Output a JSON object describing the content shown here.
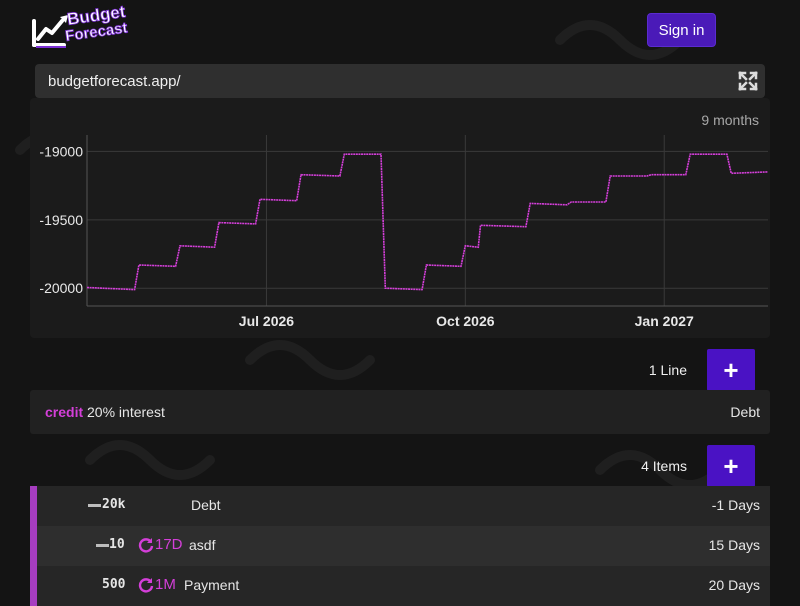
{
  "header": {
    "logo_line1": "Budget",
    "logo_line2": "Forecast",
    "signin_label": "Sign in"
  },
  "urlbar": {
    "value": "budgetforecast.app/"
  },
  "colors": {
    "accent": "#d43fd9",
    "button": "#4a12c4",
    "chart_line": "#d43fd9"
  },
  "chart_data": {
    "type": "line",
    "range_label": "9 months",
    "y_ticks": [
      -19000,
      -19500,
      -20000
    ],
    "y_tick_labels": [
      "-19000",
      "-19500",
      "-20000"
    ],
    "ylim": [
      -20130,
      -18880
    ],
    "x_ticks": [
      "2026-07-01",
      "2026-10-01",
      "2027-01-01"
    ],
    "x_tick_labels": [
      "Jul 2026",
      "Oct 2026",
      "Jan 2027"
    ],
    "xlim": [
      "2026-04-09",
      "2027-02-18"
    ],
    "grid": true,
    "series": [
      {
        "x": [
          "2026-04-09",
          "2026-05-01",
          "2026-05-03",
          "2026-05-20",
          "2026-05-22",
          "2026-06-07",
          "2026-06-09",
          "2026-06-26",
          "2026-06-28",
          "2026-07-15",
          "2026-07-17",
          "2026-08-04",
          "2026-08-06",
          "2026-08-23",
          "2026-08-25",
          "2026-09-11",
          "2026-09-13",
          "2026-09-29",
          "2026-10-01",
          "2026-10-07",
          "2026-10-08",
          "2026-10-29",
          "2026-10-31",
          "2026-11-17",
          "2026-11-19",
          "2026-12-05",
          "2026-12-07",
          "2026-12-24",
          "2026-12-26",
          "2027-01-11",
          "2027-01-13",
          "2027-01-30",
          "2027-02-01",
          "2027-02-18"
        ],
        "y": [
          -19995,
          -20010,
          -19830,
          -19840,
          -19690,
          -19700,
          -19520,
          -19530,
          -19350,
          -19360,
          -19170,
          -19180,
          -19020,
          -19020,
          -20000,
          -20010,
          -19830,
          -19840,
          -19690,
          -19700,
          -19540,
          -19550,
          -19380,
          -19390,
          -19370,
          -19370,
          -19180,
          -19180,
          -19170,
          -19170,
          -19020,
          -19020,
          -19160,
          -19150
        ]
      }
    ]
  },
  "lines_section": {
    "count_label": "1 Line",
    "add_label": "+",
    "lines": [
      {
        "tag": "credit",
        "desc": "20% interest",
        "right": "Debt"
      }
    ]
  },
  "items_section": {
    "count_label": "4 Items",
    "add_label": "+",
    "items": [
      {
        "amount": "20k",
        "repeat": "",
        "name": "Debt",
        "days": "-1 Days"
      },
      {
        "amount": "10",
        "repeat": "17D",
        "name": "asdf",
        "days": "15 Days"
      },
      {
        "amount": "500",
        "repeat": "1M",
        "name": "Payment",
        "days": "20 Days"
      }
    ]
  }
}
